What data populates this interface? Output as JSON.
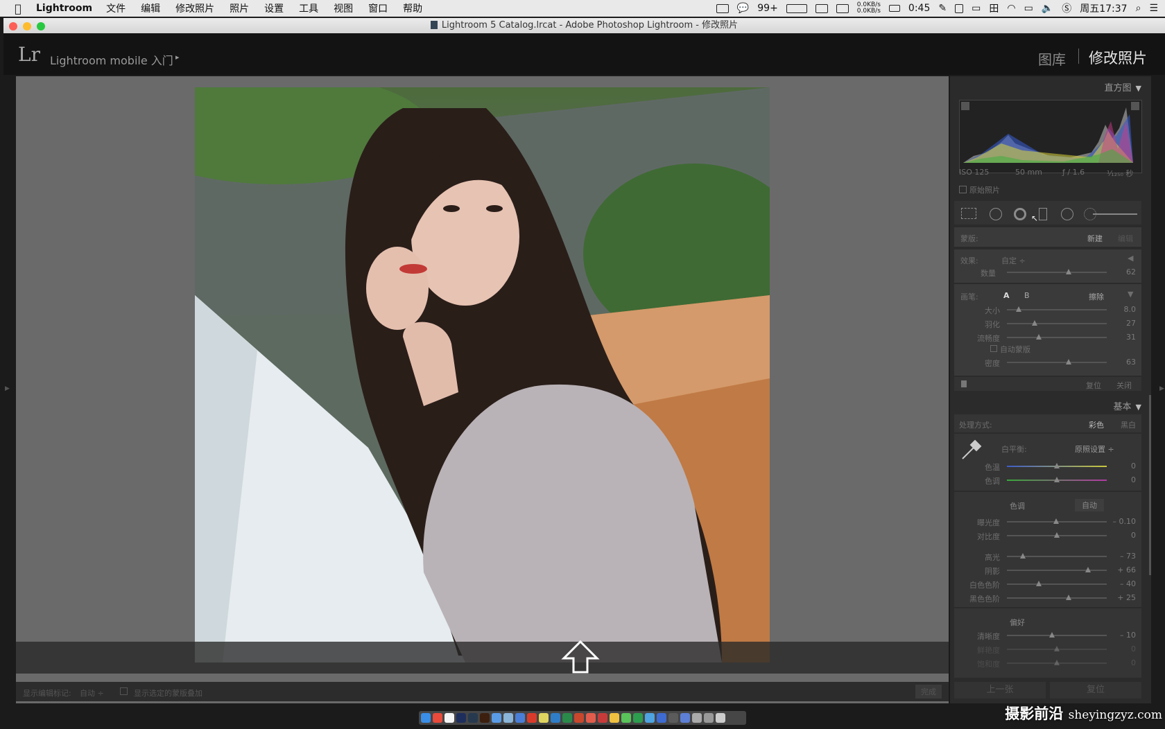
{
  "menubar": {
    "app_name": "Lightroom",
    "items": [
      "文件",
      "编辑",
      "修改照片",
      "照片",
      "设置",
      "工具",
      "视图",
      "窗口",
      "帮助"
    ],
    "wechat_badge": "99+",
    "net_up": "0.0KB/s",
    "net_down": "0.0KB/s",
    "battery_time": "0:45",
    "clock": "周五17:37"
  },
  "window": {
    "title": "Lightroom 5 Catalog.lrcat - Adobe Photoshop Lightroom - 修改照片"
  },
  "toppanel": {
    "logo": "Lr",
    "mobile_text": "Lightroom mobile 入门",
    "arrow": "▸",
    "module_library": "图库",
    "module_develop": "修改照片"
  },
  "histogram": {
    "title": "直方图",
    "iso": "ISO 125",
    "focal": "50 mm",
    "aperture": "ƒ / 1.6",
    "shutter": "¹⁄₁₂₅₀ 秒",
    "original_photo": "原始照片"
  },
  "mask": {
    "label": "蒙版:",
    "new": "新建",
    "edit": "编辑",
    "effect_label": "效果:",
    "effect_value": "自定 ÷",
    "amount_label": "数量",
    "amount_value": "62",
    "amount_level": 0.62
  },
  "brush": {
    "label": "画笔:",
    "a": "A",
    "b": "B",
    "erase": "擦除",
    "sliders": [
      {
        "label": "大小",
        "value": "8.0",
        "level": 0.12
      },
      {
        "label": "羽化",
        "value": "27",
        "level": 0.28
      },
      {
        "label": "流畅度",
        "value": "31",
        "level": 0.32
      }
    ],
    "auto_mask": "自动蒙版",
    "density_label": "密度",
    "density_value": "63",
    "density_level": 0.62,
    "reset": "复位",
    "close": "关闭"
  },
  "basic": {
    "title": "基本",
    "treatment_label": "处理方式:",
    "color": "彩色",
    "bw": "黑白",
    "wb_label": "白平衡:",
    "wb_value": "原照设置 ÷",
    "temp_label": "色温",
    "temp_value": "0",
    "tint_label": "色调",
    "tint_value": "0",
    "tone_title": "色调",
    "auto": "自动",
    "tone_sliders": [
      {
        "label": "曝光度",
        "value": "– 0.10",
        "level": 0.49
      },
      {
        "label": "对比度",
        "value": "0",
        "level": 0.5
      }
    ],
    "region_sliders": [
      {
        "label": "高光",
        "value": "– 73",
        "level": 0.16
      },
      {
        "label": "阴影",
        "value": "+ 66",
        "level": 0.81
      },
      {
        "label": "白色色阶",
        "value": "– 40",
        "level": 0.32
      },
      {
        "label": "黑色色阶",
        "value": "+ 25",
        "level": 0.62
      }
    ],
    "presence_title": "偏好",
    "presence_sliders": [
      {
        "label": "清晰度",
        "value": "– 10",
        "level": 0.45
      },
      {
        "label": "鲜艳度",
        "value": "0",
        "level": 0.5
      },
      {
        "label": "饱和度",
        "value": "0",
        "level": 0.5
      }
    ]
  },
  "footer": {
    "prev": "上一张",
    "reset": "复位",
    "show_edit_pins": "显示编辑标记:",
    "show_edit_pins_value": "自动 ÷",
    "show_mask_overlay": "显示选定的蒙版叠加",
    "done": "完成"
  },
  "watermark": {
    "cn": "摄影前沿",
    "url": "sheyingzyz.com"
  },
  "colors": {
    "menubar_bg": "#e9e9e9",
    "panel_bg": "#2b2b2b",
    "viewer_bg": "#6a6a6a"
  }
}
